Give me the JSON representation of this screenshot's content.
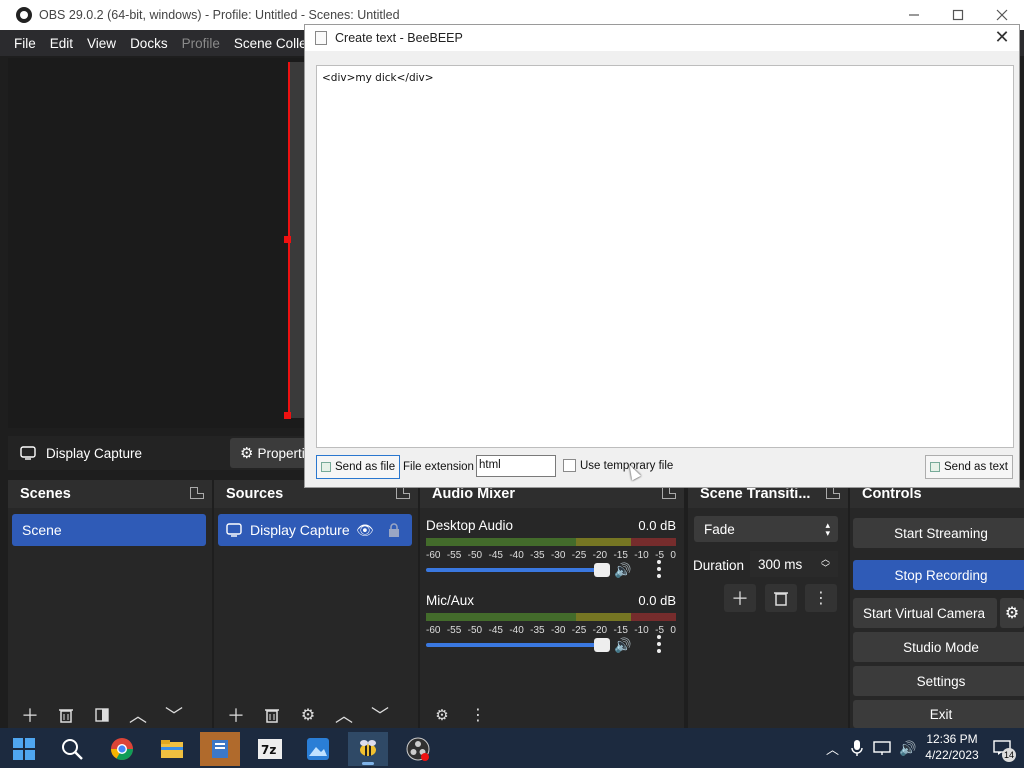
{
  "obs": {
    "title": "OBS 29.0.2 (64-bit, windows) - Profile: Untitled - Scenes: Untitled",
    "menu": [
      "File",
      "Edit",
      "View",
      "Docks",
      "Profile",
      "Scene Colle"
    ],
    "source_context": "Display Capture",
    "properties_label": "Propertie",
    "scenes": {
      "title": "Scenes",
      "items": [
        "Scene"
      ]
    },
    "sources": {
      "title": "Sources",
      "items": [
        "Display Capture"
      ]
    },
    "audio": {
      "title": "Audio Mixer",
      "tracks": [
        {
          "name": "Desktop Audio",
          "db": "0.0 dB",
          "level": 0.9
        },
        {
          "name": "Mic/Aux",
          "db": "0.0 dB",
          "level": 0.9
        }
      ],
      "scale": [
        "-60",
        "-55",
        "-50",
        "-45",
        "-40",
        "-35",
        "-30",
        "-25",
        "-20",
        "-15",
        "-10",
        "-5",
        "0"
      ]
    },
    "transitions": {
      "title": "Scene Transiti...",
      "type": "Fade",
      "duration_label": "Duration",
      "duration": "300 ms"
    },
    "controls": {
      "title": "Controls",
      "start_streaming": "Start Streaming",
      "stop_recording": "Stop Recording",
      "virtual_camera": "Start Virtual Camera",
      "studio_mode": "Studio Mode",
      "settings": "Settings",
      "exit": "Exit"
    }
  },
  "dialog": {
    "title": "Create text - BeeBEEP",
    "content": "<div>my dick</div>",
    "send_file": "Send as file",
    "ext_label": "File extension",
    "ext_value": "html",
    "temp_label": "Use temporary file",
    "send_text": "Send as text"
  },
  "taskbar": {
    "time": "12:36 PM",
    "date": "4/22/2023",
    "notifications": "14"
  },
  "colors": {
    "accent": "#2f5bb7",
    "selection_red": "#e11111"
  }
}
